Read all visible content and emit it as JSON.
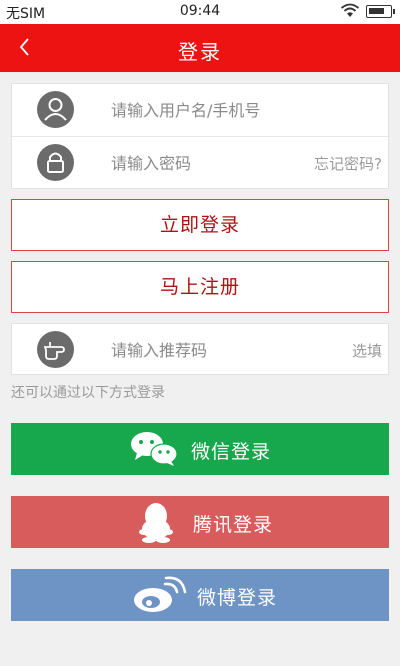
{
  "status_bar": {
    "carrier": "无SIM",
    "time": "09:44",
    "battery_level": 0.85
  },
  "header": {
    "back_icon": "chevron-left-icon",
    "title": "登录"
  },
  "login_form": {
    "username_placeholder": "请输入用户名/手机号",
    "password_placeholder": "请输入密码",
    "forgot_password": "忘记密码?",
    "username_icon": "user-avatar-icon",
    "password_icon": "lock-icon"
  },
  "buttons": {
    "login": "立即登录",
    "register": "马上注册"
  },
  "referral": {
    "placeholder": "请输入推荐码",
    "optional_label": "选填",
    "icon": "pointing-hand-icon"
  },
  "alt_login": {
    "hint": "还可以通过以下方式登录",
    "wechat": "微信登录",
    "tencent": "腾讯登录",
    "weibo": "微博登录"
  },
  "colors": {
    "header_red": "#ee1313",
    "wechat_green": "#17a84e",
    "tencent_red": "#d95c5c",
    "weibo_blue": "#6e93c5",
    "button_text_red": "#b11111"
  }
}
